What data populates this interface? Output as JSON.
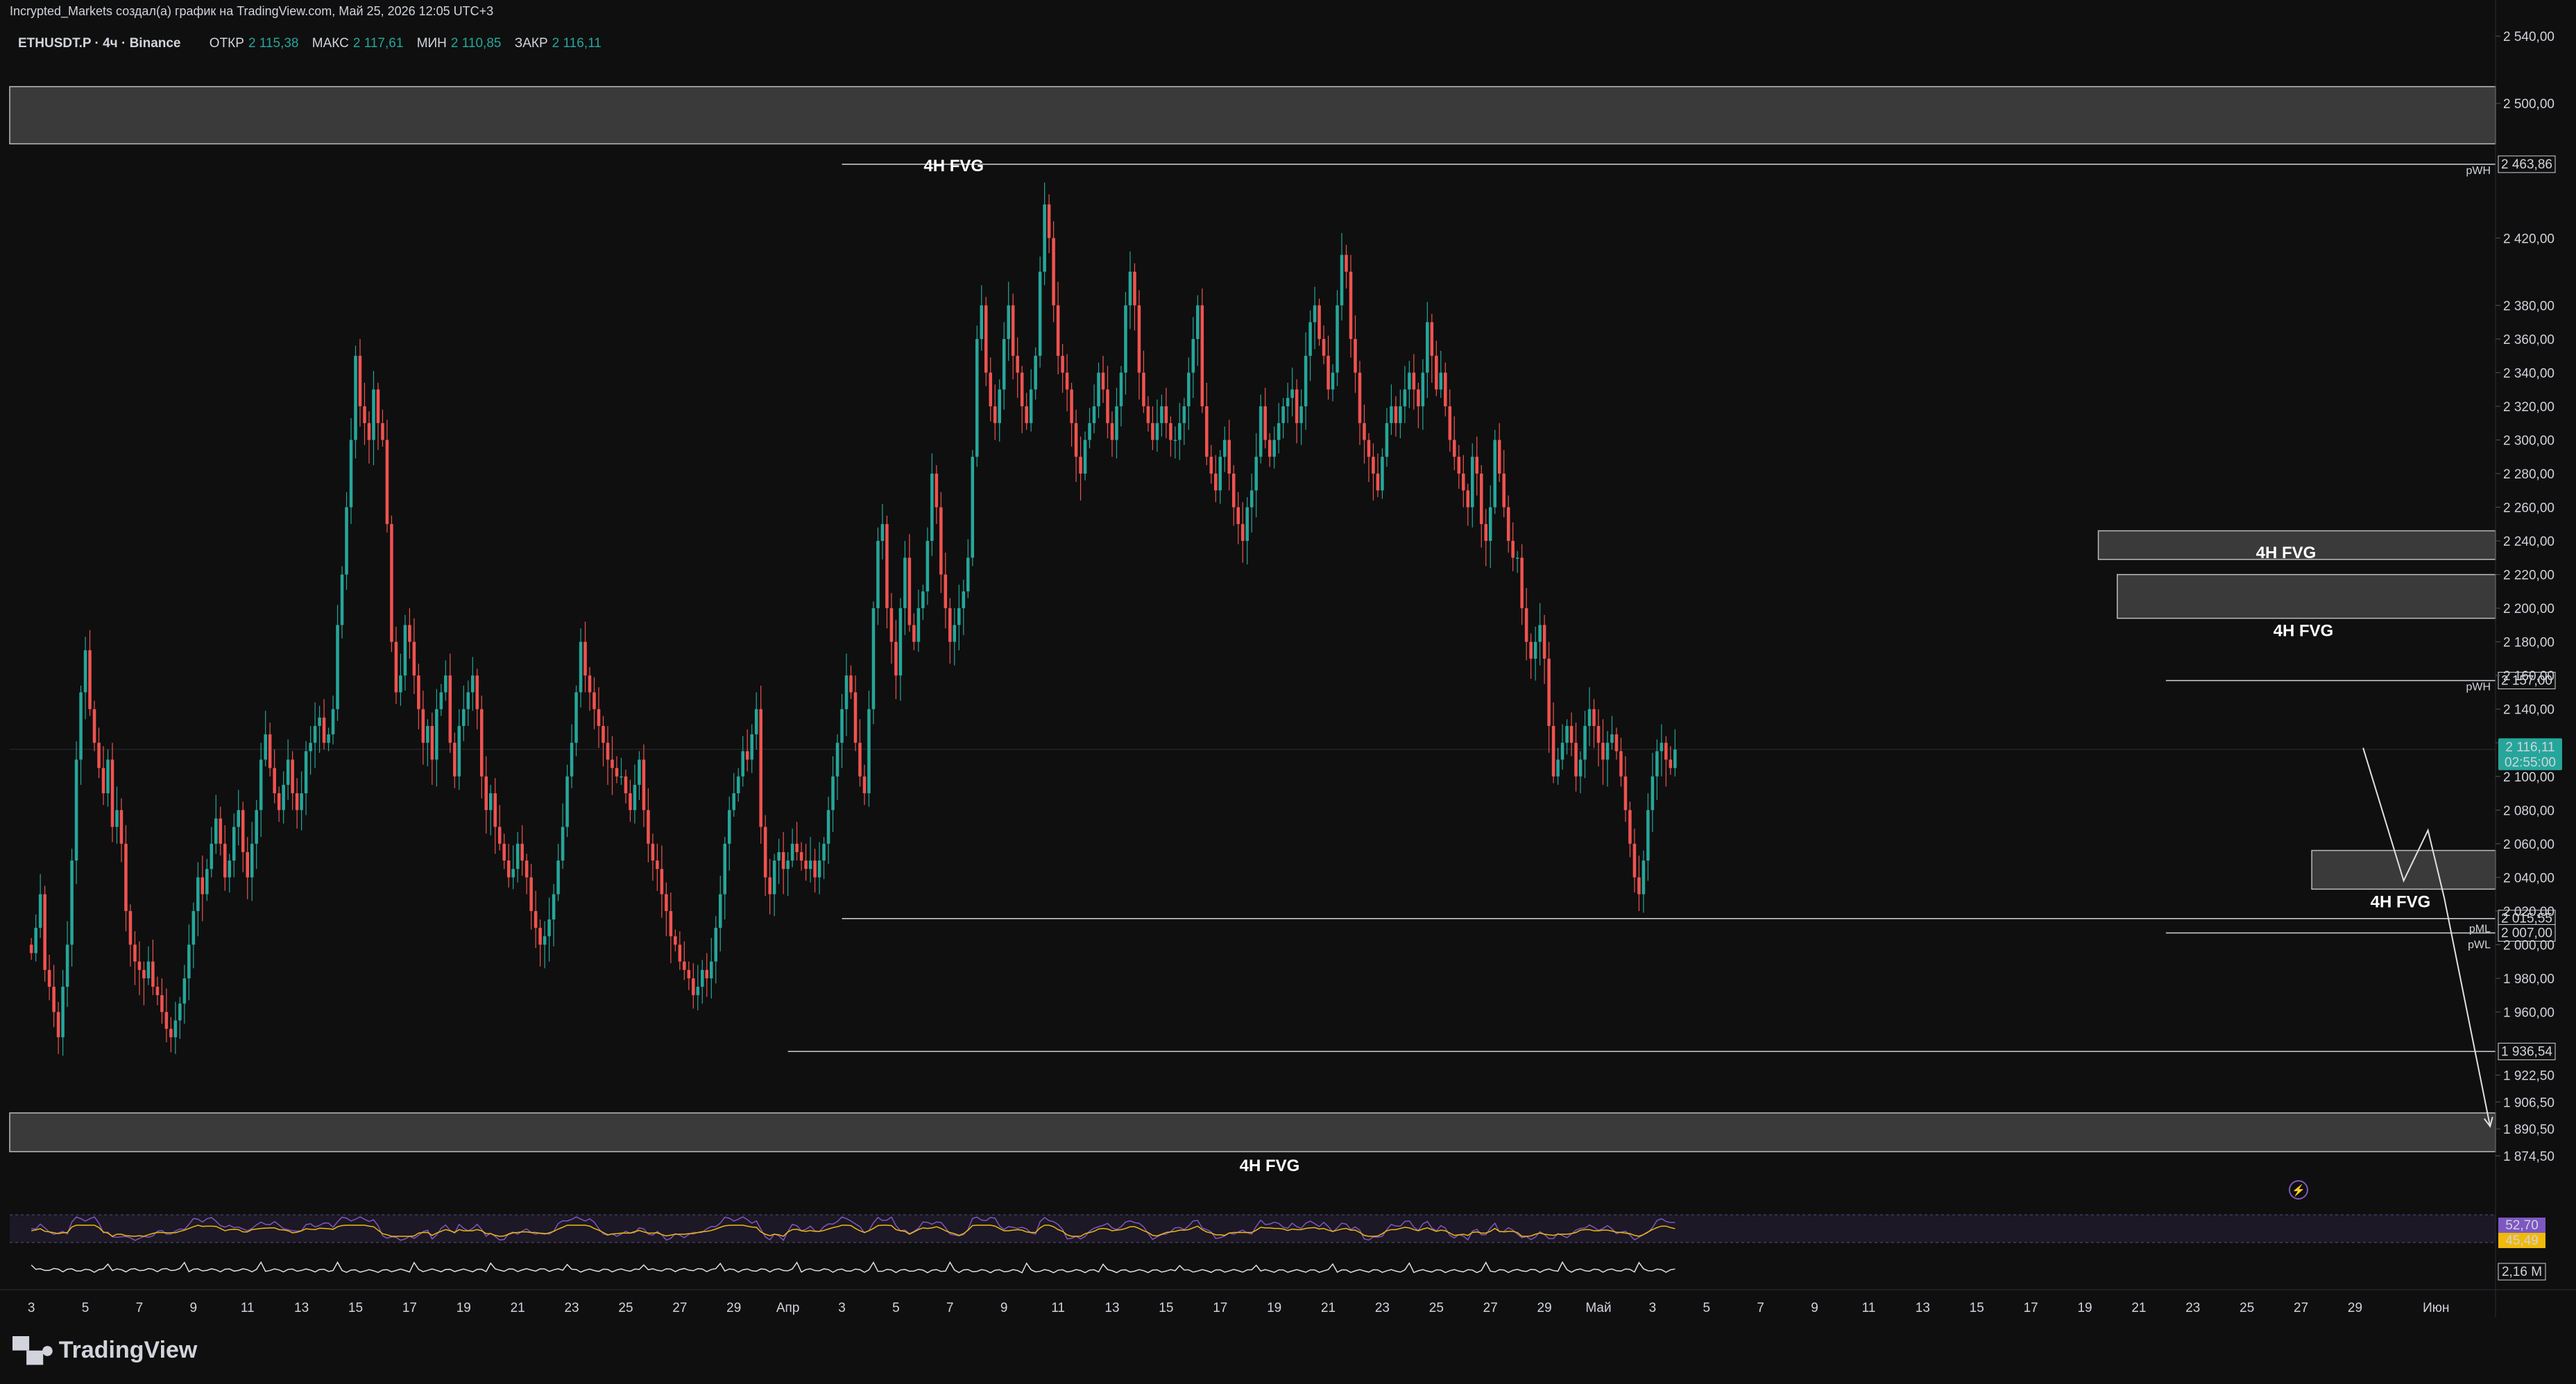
{
  "header": {
    "attribution": "Incrypted_Markets создал(а) график на TradingView.com, Май 25, 2026 12:05 UTC+3"
  },
  "legend": {
    "symbol": "ETHUSDT.P · 4ч · Binance",
    "open_label": "ОТКР",
    "open_value": "2 115,38",
    "high_label": "МАКС",
    "high_value": "2 117,61",
    "low_label": "МИН",
    "low_value": "2 110,85",
    "close_label": "ЗАКР",
    "close_value": "2 116,11"
  },
  "brand": {
    "name": "TradingView"
  },
  "colors": {
    "up": "#26a69a",
    "down": "#ef5350",
    "background": "#0f0f0f",
    "zone": "#3a3a3a",
    "rsi": "#7e57c2",
    "rsi_ma": "#f0b90b",
    "price_tag": "#26a69a"
  },
  "chart_data": {
    "type": "candlestick",
    "symbol": "ETHUSDT.P",
    "timeframe": "4ч",
    "exchange": "Binance",
    "y_axis": {
      "ylim": [
        1865,
        2545
      ],
      "ticks": [
        1874.5,
        1890.5,
        1906.5,
        1922.5,
        1960,
        1980,
        2000,
        2020,
        2040,
        2060,
        2080,
        2100,
        2120,
        2140,
        2160,
        2180,
        2200,
        2220,
        2240,
        2260,
        2280,
        2300,
        2320,
        2340,
        2360,
        2380,
        2420,
        2500,
        2540
      ],
      "tick_labels": [
        "1 874,50",
        "1 890,50",
        "1 906,50",
        "1 922,50",
        "1 960,00",
        "1 980,00",
        "2 000,00",
        "2 020,00",
        "2 040,00",
        "2 060,00",
        "2 080,00",
        "2 100,00",
        "2 120,00",
        "2 140,00",
        "2 160,00",
        "2 180,00",
        "2 200,00",
        "2 220,00",
        "2 240,00",
        "2 260,00",
        "2 280,00",
        "2 300,00",
        "2 320,00",
        "2 340,00",
        "2 360,00",
        "2 380,00",
        "2 420,00",
        "2 500,00",
        "2 540,00"
      ]
    },
    "x_axis": {
      "labels": [
        "3",
        "5",
        "7",
        "9",
        "11",
        "13",
        "15",
        "17",
        "19",
        "21",
        "23",
        "25",
        "27",
        "29",
        "Апр",
        "3",
        "5",
        "7",
        "9",
        "11",
        "13",
        "15",
        "17",
        "19",
        "21",
        "23",
        "25",
        "27",
        "29",
        "Май",
        "3",
        "5",
        "7",
        "9",
        "11",
        "13",
        "15",
        "17",
        "19",
        "21",
        "23",
        "25",
        "27",
        "29",
        "Июн"
      ],
      "day_index": [
        0,
        2,
        4,
        6,
        8,
        10,
        12,
        14,
        16,
        18,
        20,
        22,
        24,
        26,
        28,
        30,
        32,
        34,
        36,
        38,
        40,
        42,
        44,
        46,
        48,
        50,
        52,
        54,
        56,
        58,
        60,
        62,
        64,
        66,
        68,
        70,
        72,
        74,
        76,
        78,
        80,
        82,
        84,
        86,
        89
      ],
      "range_days": [
        -0.8,
        91.2
      ]
    },
    "series": {
      "first_day": 0,
      "bars_per_day": 6,
      "closes": [
        1995,
        2010,
        2030,
        1985,
        1975,
        1960,
        1945,
        1975,
        2000,
        2050,
        2110,
        2150,
        2175,
        2140,
        2120,
        2105,
        2090,
        2110,
        2070,
        2080,
        2060,
        2020,
        2000,
        1990,
        1985,
        1980,
        1990,
        1975,
        1970,
        1960,
        1950,
        1945,
        1955,
        1965,
        1980,
        2000,
        2020,
        2040,
        2030,
        2045,
        2060,
        2075,
        2060,
        2040,
        2050,
        2070,
        2080,
        2055,
        2040,
        2060,
        2080,
        2110,
        2125,
        2105,
        2090,
        2080,
        2095,
        2110,
        2090,
        2080,
        2090,
        2115,
        2120,
        2130,
        2135,
        2120,
        2125,
        2140,
        2190,
        2220,
        2260,
        2300,
        2350,
        2320,
        2310,
        2300,
        2330,
        2310,
        2300,
        2250,
        2180,
        2150,
        2160,
        2190,
        2180,
        2160,
        2140,
        2120,
        2130,
        2110,
        2140,
        2150,
        2160,
        2120,
        2100,
        2130,
        2140,
        2150,
        2160,
        2140,
        2100,
        2080,
        2090,
        2070,
        2060,
        2050,
        2040,
        2045,
        2060,
        2050,
        2040,
        2020,
        2010,
        2000,
        2005,
        2015,
        2030,
        2050,
        2070,
        2100,
        2120,
        2150,
        2180,
        2160,
        2150,
        2140,
        2130,
        2120,
        2110,
        2105,
        2100,
        2100,
        2090,
        2080,
        2095,
        2110,
        2080,
        2060,
        2050,
        2045,
        2030,
        2020,
        2005,
        2000,
        1990,
        1985,
        1980,
        1970,
        1975,
        1985,
        1980,
        1990,
        2010,
        2030,
        2060,
        2080,
        2090,
        2100,
        2115,
        2110,
        2125,
        2140,
        2070,
        2040,
        2030,
        2050,
        2055,
        2045,
        2050,
        2060,
        2055,
        2050,
        2045,
        2050,
        2040,
        2050,
        2060,
        2080,
        2100,
        2120,
        2140,
        2160,
        2150,
        2120,
        2100,
        2090,
        2140,
        2200,
        2240,
        2250,
        2200,
        2180,
        2160,
        2200,
        2230,
        2190,
        2180,
        2200,
        2210,
        2240,
        2280,
        2260,
        2220,
        2200,
        2180,
        2190,
        2200,
        2210,
        2230,
        2290,
        2360,
        2380,
        2340,
        2320,
        2310,
        2330,
        2360,
        2380,
        2350,
        2340,
        2320,
        2310,
        2330,
        2350,
        2400,
        2440,
        2420,
        2380,
        2350,
        2340,
        2330,
        2310,
        2290,
        2280,
        2300,
        2310,
        2320,
        2340,
        2330,
        2310,
        2300,
        2320,
        2340,
        2380,
        2400,
        2380,
        2340,
        2320,
        2310,
        2300,
        2310,
        2320,
        2310,
        2300,
        2300,
        2310,
        2320,
        2340,
        2360,
        2380,
        2320,
        2290,
        2280,
        2270,
        2290,
        2300,
        2280,
        2260,
        2250,
        2240,
        2260,
        2270,
        2290,
        2320,
        2300,
        2290,
        2300,
        2310,
        2320,
        2325,
        2330,
        2310,
        2320,
        2350,
        2370,
        2380,
        2360,
        2350,
        2330,
        2340,
        2380,
        2410,
        2400,
        2360,
        2340,
        2310,
        2300,
        2290,
        2280,
        2270,
        2290,
        2310,
        2320,
        2310,
        2320,
        2330,
        2340,
        2330,
        2320,
        2340,
        2370,
        2350,
        2330,
        2340,
        2320,
        2300,
        2290,
        2280,
        2270,
        2260,
        2290,
        2280,
        2250,
        2240,
        2260,
        2300,
        2280,
        2260,
        2240,
        2230,
        2230,
        2200,
        2180,
        2170,
        2180,
        2190,
        2170,
        2130,
        2100,
        2110,
        2120,
        2130,
        2120,
        2100,
        2110,
        2130,
        2140,
        2130,
        2120,
        2110,
        2120,
        2125,
        2115,
        2100,
        2080,
        2060,
        2040,
        2030,
        2050,
        2080,
        2100,
        2115,
        2120,
        2110,
        2105,
        2116
      ]
    },
    "candle_up_color": "#26a69a",
    "candle_down_color": "#ef5350",
    "last_price": {
      "value": 2116.11,
      "label": "2 116,11",
      "countdown": "02:55:00"
    },
    "level_lines": [
      {
        "value": 2463.86,
        "label": "2 463,86",
        "tag": "pWH",
        "from_day": 30
      },
      {
        "value": 2157.0,
        "label": "2 157,00",
        "tag": "pWH",
        "from_day": 79
      },
      {
        "value": 2015.55,
        "label": "2 015,55",
        "tag": "pML",
        "from_day": 30
      },
      {
        "value": 2007.0,
        "label": "2 007,00",
        "tag": "pWL",
        "from_day": 79
      },
      {
        "value": 1936.54,
        "label": "1 936,54",
        "tag": "",
        "from_day": 28
      }
    ],
    "zones": [
      {
        "top": 2510,
        "bottom": 2476,
        "from_day": -1,
        "label": ""
      },
      {
        "top": 2246,
        "bottom": 2229,
        "from_day": 76.5,
        "label": "4H FVG"
      },
      {
        "top": 2220,
        "bottom": 2194,
        "from_day": 77.2,
        "label": "4H FVG"
      },
      {
        "top": 2056,
        "bottom": 2033,
        "from_day": 84.4,
        "label": "4H FVG"
      },
      {
        "top": 1900,
        "bottom": 1877,
        "from_day": -1,
        "label": "4H FVG"
      }
    ],
    "annotations": [
      {
        "text": "4H FVG",
        "day": 32,
        "price": 2463
      }
    ],
    "projection": [
      [
        86.3,
        2117
      ],
      [
        87.8,
        2038
      ],
      [
        88.7,
        2068
      ],
      [
        89.3,
        2028
      ],
      [
        91.0,
        1892
      ]
    ],
    "rsi": {
      "values": [
        "52,70",
        "45,49"
      ]
    },
    "volume": {
      "label": "2,16 M"
    }
  }
}
